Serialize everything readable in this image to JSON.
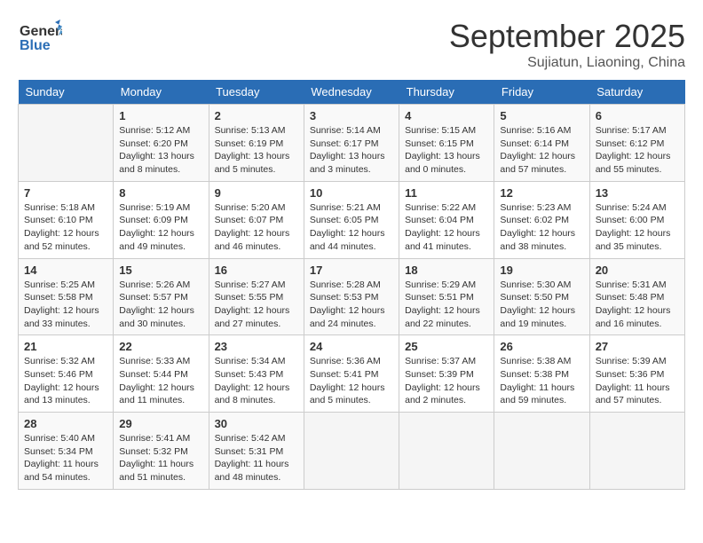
{
  "logo": {
    "line1": "General",
    "line2": "Blue"
  },
  "title": "September 2025",
  "subtitle": "Sujiatun, Liaoning, China",
  "days_of_week": [
    "Sunday",
    "Monday",
    "Tuesday",
    "Wednesday",
    "Thursday",
    "Friday",
    "Saturday"
  ],
  "weeks": [
    [
      {
        "day": "",
        "info": ""
      },
      {
        "day": "1",
        "info": "Sunrise: 5:12 AM\nSunset: 6:20 PM\nDaylight: 13 hours\nand 8 minutes."
      },
      {
        "day": "2",
        "info": "Sunrise: 5:13 AM\nSunset: 6:19 PM\nDaylight: 13 hours\nand 5 minutes."
      },
      {
        "day": "3",
        "info": "Sunrise: 5:14 AM\nSunset: 6:17 PM\nDaylight: 13 hours\nand 3 minutes."
      },
      {
        "day": "4",
        "info": "Sunrise: 5:15 AM\nSunset: 6:15 PM\nDaylight: 13 hours\nand 0 minutes."
      },
      {
        "day": "5",
        "info": "Sunrise: 5:16 AM\nSunset: 6:14 PM\nDaylight: 12 hours\nand 57 minutes."
      },
      {
        "day": "6",
        "info": "Sunrise: 5:17 AM\nSunset: 6:12 PM\nDaylight: 12 hours\nand 55 minutes."
      }
    ],
    [
      {
        "day": "7",
        "info": "Sunrise: 5:18 AM\nSunset: 6:10 PM\nDaylight: 12 hours\nand 52 minutes."
      },
      {
        "day": "8",
        "info": "Sunrise: 5:19 AM\nSunset: 6:09 PM\nDaylight: 12 hours\nand 49 minutes."
      },
      {
        "day": "9",
        "info": "Sunrise: 5:20 AM\nSunset: 6:07 PM\nDaylight: 12 hours\nand 46 minutes."
      },
      {
        "day": "10",
        "info": "Sunrise: 5:21 AM\nSunset: 6:05 PM\nDaylight: 12 hours\nand 44 minutes."
      },
      {
        "day": "11",
        "info": "Sunrise: 5:22 AM\nSunset: 6:04 PM\nDaylight: 12 hours\nand 41 minutes."
      },
      {
        "day": "12",
        "info": "Sunrise: 5:23 AM\nSunset: 6:02 PM\nDaylight: 12 hours\nand 38 minutes."
      },
      {
        "day": "13",
        "info": "Sunrise: 5:24 AM\nSunset: 6:00 PM\nDaylight: 12 hours\nand 35 minutes."
      }
    ],
    [
      {
        "day": "14",
        "info": "Sunrise: 5:25 AM\nSunset: 5:58 PM\nDaylight: 12 hours\nand 33 minutes."
      },
      {
        "day": "15",
        "info": "Sunrise: 5:26 AM\nSunset: 5:57 PM\nDaylight: 12 hours\nand 30 minutes."
      },
      {
        "day": "16",
        "info": "Sunrise: 5:27 AM\nSunset: 5:55 PM\nDaylight: 12 hours\nand 27 minutes."
      },
      {
        "day": "17",
        "info": "Sunrise: 5:28 AM\nSunset: 5:53 PM\nDaylight: 12 hours\nand 24 minutes."
      },
      {
        "day": "18",
        "info": "Sunrise: 5:29 AM\nSunset: 5:51 PM\nDaylight: 12 hours\nand 22 minutes."
      },
      {
        "day": "19",
        "info": "Sunrise: 5:30 AM\nSunset: 5:50 PM\nDaylight: 12 hours\nand 19 minutes."
      },
      {
        "day": "20",
        "info": "Sunrise: 5:31 AM\nSunset: 5:48 PM\nDaylight: 12 hours\nand 16 minutes."
      }
    ],
    [
      {
        "day": "21",
        "info": "Sunrise: 5:32 AM\nSunset: 5:46 PM\nDaylight: 12 hours\nand 13 minutes."
      },
      {
        "day": "22",
        "info": "Sunrise: 5:33 AM\nSunset: 5:44 PM\nDaylight: 12 hours\nand 11 minutes."
      },
      {
        "day": "23",
        "info": "Sunrise: 5:34 AM\nSunset: 5:43 PM\nDaylight: 12 hours\nand 8 minutes."
      },
      {
        "day": "24",
        "info": "Sunrise: 5:36 AM\nSunset: 5:41 PM\nDaylight: 12 hours\nand 5 minutes."
      },
      {
        "day": "25",
        "info": "Sunrise: 5:37 AM\nSunset: 5:39 PM\nDaylight: 12 hours\nand 2 minutes."
      },
      {
        "day": "26",
        "info": "Sunrise: 5:38 AM\nSunset: 5:38 PM\nDaylight: 11 hours\nand 59 minutes."
      },
      {
        "day": "27",
        "info": "Sunrise: 5:39 AM\nSunset: 5:36 PM\nDaylight: 11 hours\nand 57 minutes."
      }
    ],
    [
      {
        "day": "28",
        "info": "Sunrise: 5:40 AM\nSunset: 5:34 PM\nDaylight: 11 hours\nand 54 minutes."
      },
      {
        "day": "29",
        "info": "Sunrise: 5:41 AM\nSunset: 5:32 PM\nDaylight: 11 hours\nand 51 minutes."
      },
      {
        "day": "30",
        "info": "Sunrise: 5:42 AM\nSunset: 5:31 PM\nDaylight: 11 hours\nand 48 minutes."
      },
      {
        "day": "",
        "info": ""
      },
      {
        "day": "",
        "info": ""
      },
      {
        "day": "",
        "info": ""
      },
      {
        "day": "",
        "info": ""
      }
    ]
  ]
}
